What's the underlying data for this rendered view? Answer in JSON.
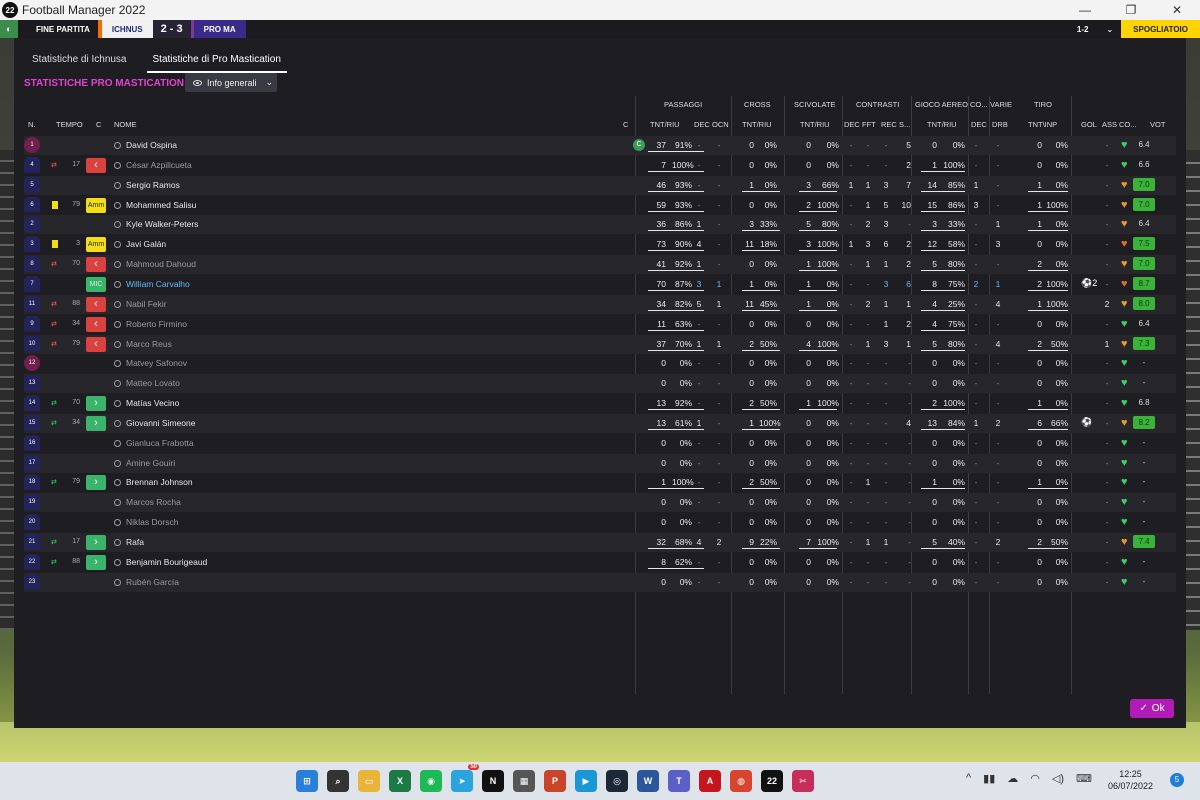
{
  "window": {
    "title": "Football Manager 2022",
    "app_badge": "22",
    "buttons": [
      "—",
      "❐",
      "✕"
    ]
  },
  "gamebar": {
    "club_badge": "◐",
    "phase": "FINE PARTITA",
    "home_team": "ICHNUS",
    "score": "2 - 3",
    "away_team": "PRO MA",
    "counter": "1-2",
    "chevron": "⌄",
    "action": "SPOGLIATOIO"
  },
  "tabs": [
    "Statistiche di Ichnusa",
    "Statistiche di Pro Mastication"
  ],
  "section_title": "STATISTICHE PRO MASTICATION",
  "view_select": "Info generali",
  "ok_label": "Ok",
  "groups": {
    "passaggi": "PASSAGGI",
    "cross": "CROSS",
    "scivolate": "SCIVOLATE",
    "contrasti": "CONTRASTI",
    "aereo": "GIOCO AEREO",
    "co": "CO...",
    "varie": "VARIE",
    "tiro": "TIRO"
  },
  "headers": {
    "n": "N.",
    "tempo": "TEMPO",
    "c": "C",
    "nome": "NOME",
    "cap": "C",
    "pass_tnt": "TNT/RIU",
    "dec": "DEC",
    "ocn": "OCN",
    "cross_tnt": "TNT/RIU",
    "sciv_tnt": "TNT/RIU",
    "c_dec": "DEC",
    "c_fft": "FFT",
    "c_rec": "REC",
    "c_s": "S...",
    "aereo_tnt": "TNT/RIU",
    "co_dec": "DEC",
    "drb": "DRB",
    "tiro_tnt": "TNT\\INP",
    "gol": "GOL",
    "ass": "ASS",
    "cond": "CO...",
    "vot": "VOT"
  },
  "players": [
    {
      "n": "1",
      "gk": true,
      "tempo": "",
      "min": "",
      "badge": "",
      "name": "David Ospina",
      "style": "",
      "cap": "C",
      "pt": "37",
      "pp": "91%",
      "dec": "-",
      "ocn": "-",
      "ct": "0",
      "cp": "0%",
      "st": "0",
      "sp": "0%",
      "cd": "-",
      "cf": "-",
      "cr": "-",
      "cs": "5",
      "at": "0",
      "ap": "0%",
      "ad": "-",
      "drb": "-",
      "tt": "0",
      "tp": "0%",
      "gol": "",
      "ass": "-",
      "heart": "#39d16a",
      "vot": "6.4",
      "vstyle": ""
    },
    {
      "n": "4",
      "gk": false,
      "tempo": "out",
      "min": "17",
      "badge": "out",
      "name": "César Azpilicueta",
      "style": "dim",
      "cap": "",
      "pt": "7",
      "pp": "100%",
      "dec": "-",
      "ocn": "-",
      "ct": "0",
      "cp": "0%",
      "st": "0",
      "sp": "0%",
      "cd": "-",
      "cf": "-",
      "cr": "-",
      "cs": "2",
      "at": "1",
      "ap": "100%",
      "ad": "-",
      "drb": "-",
      "tt": "0",
      "tp": "0%",
      "gol": "",
      "ass": "-",
      "heart": "#39d16a",
      "vot": "6.6",
      "vstyle": ""
    },
    {
      "n": "5",
      "gk": false,
      "tempo": "",
      "min": "",
      "badge": "",
      "name": "Sergio Ramos",
      "style": "",
      "cap": "",
      "pt": "46",
      "pp": "93%",
      "dec": "-",
      "ocn": "-",
      "ct": "1",
      "cp": "0%",
      "st": "3",
      "sp": "66%",
      "cd": "1",
      "cf": "1",
      "cr": "3",
      "cs": "7",
      "at": "14",
      "ap": "85%",
      "ad": "1",
      "drb": "-",
      "tt": "1",
      "tp": "0%",
      "gol": "",
      "ass": "-",
      "heart": "#e59a2a",
      "vot": "7.0",
      "vstyle": "high"
    },
    {
      "n": "6",
      "gk": false,
      "tempo": "yellow",
      "min": "79",
      "badge": "amm",
      "name": "Mohammed Salisu",
      "style": "",
      "cap": "",
      "pt": "59",
      "pp": "93%",
      "dec": "-",
      "ocn": "-",
      "ct": "0",
      "cp": "0%",
      "st": "2",
      "sp": "100%",
      "cd": "-",
      "cf": "1",
      "cr": "5",
      "cs": "10",
      "at": "15",
      "ap": "86%",
      "ad": "3",
      "drb": "-",
      "tt": "1",
      "tp": "100%",
      "gol": "",
      "ass": "-",
      "heart": "#e59a2a",
      "vot": "7.0",
      "vstyle": "high"
    },
    {
      "n": "2",
      "gk": false,
      "tempo": "",
      "min": "",
      "badge": "",
      "name": "Kyle Walker-Peters",
      "style": "",
      "cap": "",
      "pt": "36",
      "pp": "86%",
      "dec": "1",
      "ocn": "-",
      "ct": "3",
      "cp": "33%",
      "st": "5",
      "sp": "80%",
      "cd": "-",
      "cf": "2",
      "cr": "3",
      "cs": "-",
      "at": "3",
      "ap": "33%",
      "ad": "-",
      "drb": "1",
      "tt": "1",
      "tp": "0%",
      "gol": "",
      "ass": "-",
      "heart": "#e59a2a",
      "vot": "6.4",
      "vstyle": ""
    },
    {
      "n": "3",
      "gk": false,
      "tempo": "yellow",
      "min": "3",
      "badge": "amm",
      "name": "Javi Galán",
      "style": "",
      "cap": "",
      "pt": "73",
      "pp": "90%",
      "dec": "4",
      "ocn": "-",
      "ct": "11",
      "cp": "18%",
      "st": "3",
      "sp": "100%",
      "cd": "1",
      "cf": "3",
      "cr": "6",
      "cs": "2",
      "at": "12",
      "ap": "58%",
      "ad": "-",
      "drb": "3",
      "tt": "0",
      "tp": "0%",
      "gol": "",
      "ass": "-",
      "heart": "#e46a2a",
      "vot": "7.5",
      "vstyle": "high"
    },
    {
      "n": "8",
      "gk": false,
      "tempo": "out",
      "min": "70",
      "badge": "out",
      "name": "Mahmoud Dahoud",
      "style": "dim",
      "cap": "",
      "pt": "41",
      "pp": "92%",
      "dec": "1",
      "ocn": "-",
      "ct": "0",
      "cp": "0%",
      "st": "1",
      "sp": "100%",
      "cd": "-",
      "cf": "1",
      "cr": "1",
      "cs": "2",
      "at": "5",
      "ap": "80%",
      "ad": "-",
      "drb": "-",
      "tt": "2",
      "tp": "0%",
      "gol": "",
      "ass": "-",
      "heart": "#e59a2a",
      "vot": "7.0",
      "vstyle": "high"
    },
    {
      "n": "7",
      "gk": false,
      "tempo": "",
      "min": "",
      "badge": "mic",
      "name": "William Carvalho",
      "style": "hl",
      "cap": "",
      "pt": "70",
      "pp": "87%",
      "dec": "3",
      "ocn": "1",
      "ct": "1",
      "cp": "0%",
      "st": "1",
      "sp": "0%",
      "cd": "-",
      "cf": "-",
      "cr": "3",
      "cs": "6",
      "at": "8",
      "ap": "75%",
      "ad": "2",
      "drb": "1",
      "tt": "2",
      "tp": "100%",
      "gol": "⚽2",
      "ass": "-",
      "heart": "#e46a2a",
      "vot": "8.7",
      "vstyle": "high"
    },
    {
      "n": "11",
      "gk": false,
      "tempo": "out",
      "min": "88",
      "badge": "out",
      "name": "Nabil Fekir",
      "style": "dim",
      "cap": "",
      "pt": "34",
      "pp": "82%",
      "dec": "5",
      "ocn": "1",
      "ct": "11",
      "cp": "45%",
      "st": "1",
      "sp": "0%",
      "cd": "-",
      "cf": "2",
      "cr": "1",
      "cs": "1",
      "at": "4",
      "ap": "25%",
      "ad": "-",
      "drb": "4",
      "tt": "1",
      "tp": "100%",
      "gol": "",
      "ass": "2",
      "heart": "#e59a2a",
      "vot": "8.0",
      "vstyle": "high"
    },
    {
      "n": "9",
      "gk": false,
      "tempo": "out",
      "min": "34",
      "badge": "out",
      "name": "Roberto Firmino",
      "style": "dim",
      "cap": "",
      "pt": "11",
      "pp": "63%",
      "dec": "-",
      "ocn": "-",
      "ct": "0",
      "cp": "0%",
      "st": "0",
      "sp": "0%",
      "cd": "-",
      "cf": "-",
      "cr": "1",
      "cs": "2",
      "at": "4",
      "ap": "75%",
      "ad": "-",
      "drb": "-",
      "tt": "0",
      "tp": "0%",
      "gol": "",
      "ass": "-",
      "heart": "#39d16a",
      "vot": "6.4",
      "vstyle": ""
    },
    {
      "n": "10",
      "gk": false,
      "tempo": "out",
      "min": "79",
      "badge": "out",
      "name": "Marco Reus",
      "style": "dim",
      "cap": "",
      "pt": "37",
      "pp": "70%",
      "dec": "1",
      "ocn": "1",
      "ct": "2",
      "cp": "50%",
      "st": "4",
      "sp": "100%",
      "cd": "-",
      "cf": "1",
      "cr": "3",
      "cs": "1",
      "at": "5",
      "ap": "80%",
      "ad": "-",
      "drb": "4",
      "tt": "2",
      "tp": "50%",
      "gol": "",
      "ass": "1",
      "heart": "#e59a2a",
      "vot": "7.3",
      "vstyle": "high"
    },
    {
      "n": "12",
      "gk": true,
      "tempo": "",
      "min": "",
      "badge": "",
      "name": "Matvey Safonov",
      "style": "dim",
      "cap": "",
      "pt": "0",
      "pp": "0%",
      "dec": "-",
      "ocn": "-",
      "ct": "0",
      "cp": "0%",
      "st": "0",
      "sp": "0%",
      "cd": "-",
      "cf": "-",
      "cr": "-",
      "cs": "-",
      "at": "0",
      "ap": "0%",
      "ad": "-",
      "drb": "-",
      "tt": "0",
      "tp": "0%",
      "gol": "",
      "ass": "-",
      "heart": "#39d16a",
      "vot": "-",
      "vstyle": ""
    },
    {
      "n": "13",
      "gk": false,
      "tempo": "",
      "min": "",
      "badge": "",
      "name": "Matteo Lovato",
      "style": "dim",
      "cap": "",
      "pt": "0",
      "pp": "0%",
      "dec": "-",
      "ocn": "-",
      "ct": "0",
      "cp": "0%",
      "st": "0",
      "sp": "0%",
      "cd": "-",
      "cf": "-",
      "cr": "-",
      "cs": "-",
      "at": "0",
      "ap": "0%",
      "ad": "-",
      "drb": "-",
      "tt": "0",
      "tp": "0%",
      "gol": "",
      "ass": "-",
      "heart": "#39d16a",
      "vot": "-",
      "vstyle": ""
    },
    {
      "n": "14",
      "gk": false,
      "tempo": "in",
      "min": "70",
      "badge": "in",
      "name": "Matías Vecino",
      "style": "",
      "cap": "",
      "pt": "13",
      "pp": "92%",
      "dec": "-",
      "ocn": "-",
      "ct": "2",
      "cp": "50%",
      "st": "1",
      "sp": "100%",
      "cd": "-",
      "cf": "-",
      "cr": "-",
      "cs": "-",
      "at": "2",
      "ap": "100%",
      "ad": "-",
      "drb": "-",
      "tt": "1",
      "tp": "0%",
      "gol": "",
      "ass": "-",
      "heart": "#39d16a",
      "vot": "6.8",
      "vstyle": ""
    },
    {
      "n": "15",
      "gk": false,
      "tempo": "in",
      "min": "34",
      "badge": "in",
      "name": "Giovanni Simeone",
      "style": "",
      "cap": "",
      "pt": "13",
      "pp": "61%",
      "dec": "1",
      "ocn": "-",
      "ct": "1",
      "cp": "100%",
      "st": "0",
      "sp": "0%",
      "cd": "-",
      "cf": "-",
      "cr": "-",
      "cs": "4",
      "at": "13",
      "ap": "84%",
      "ad": "1",
      "drb": "2",
      "tt": "6",
      "tp": "66%",
      "gol": "⚽",
      "ass": "-",
      "heart": "#e59a2a",
      "vot": "8.2",
      "vstyle": "high"
    },
    {
      "n": "16",
      "gk": false,
      "tempo": "",
      "min": "",
      "badge": "",
      "name": "Gianluca Frabotta",
      "style": "dim",
      "cap": "",
      "pt": "0",
      "pp": "0%",
      "dec": "-",
      "ocn": "-",
      "ct": "0",
      "cp": "0%",
      "st": "0",
      "sp": "0%",
      "cd": "-",
      "cf": "-",
      "cr": "-",
      "cs": "-",
      "at": "0",
      "ap": "0%",
      "ad": "-",
      "drb": "-",
      "tt": "0",
      "tp": "0%",
      "gol": "",
      "ass": "-",
      "heart": "#39d16a",
      "vot": "-",
      "vstyle": ""
    },
    {
      "n": "17",
      "gk": false,
      "tempo": "",
      "min": "",
      "badge": "",
      "name": "Amine Gouiri",
      "style": "dim",
      "cap": "",
      "pt": "0",
      "pp": "0%",
      "dec": "-",
      "ocn": "-",
      "ct": "0",
      "cp": "0%",
      "st": "0",
      "sp": "0%",
      "cd": "-",
      "cf": "-",
      "cr": "-",
      "cs": "-",
      "at": "0",
      "ap": "0%",
      "ad": "-",
      "drb": "-",
      "tt": "0",
      "tp": "0%",
      "gol": "",
      "ass": "-",
      "heart": "#39d16a",
      "vot": "-",
      "vstyle": ""
    },
    {
      "n": "18",
      "gk": false,
      "tempo": "in",
      "min": "79",
      "badge": "in",
      "name": "Brennan Johnson",
      "style": "",
      "cap": "",
      "pt": "1",
      "pp": "100%",
      "dec": "-",
      "ocn": "-",
      "ct": "2",
      "cp": "50%",
      "st": "0",
      "sp": "0%",
      "cd": "-",
      "cf": "1",
      "cr": "-",
      "cs": "-",
      "at": "1",
      "ap": "0%",
      "ad": "-",
      "drb": "-",
      "tt": "1",
      "tp": "0%",
      "gol": "",
      "ass": "-",
      "heart": "#39d16a",
      "vot": "-",
      "vstyle": ""
    },
    {
      "n": "19",
      "gk": false,
      "tempo": "",
      "min": "",
      "badge": "",
      "name": "Marcos Rocha",
      "style": "dim",
      "cap": "",
      "pt": "0",
      "pp": "0%",
      "dec": "-",
      "ocn": "-",
      "ct": "0",
      "cp": "0%",
      "st": "0",
      "sp": "0%",
      "cd": "-",
      "cf": "-",
      "cr": "-",
      "cs": "-",
      "at": "0",
      "ap": "0%",
      "ad": "-",
      "drb": "-",
      "tt": "0",
      "tp": "0%",
      "gol": "",
      "ass": "-",
      "heart": "#39d16a",
      "vot": "-",
      "vstyle": ""
    },
    {
      "n": "20",
      "gk": false,
      "tempo": "",
      "min": "",
      "badge": "",
      "name": "Niklas Dorsch",
      "style": "dim",
      "cap": "",
      "pt": "0",
      "pp": "0%",
      "dec": "-",
      "ocn": "-",
      "ct": "0",
      "cp": "0%",
      "st": "0",
      "sp": "0%",
      "cd": "-",
      "cf": "-",
      "cr": "-",
      "cs": "-",
      "at": "0",
      "ap": "0%",
      "ad": "-",
      "drb": "-",
      "tt": "0",
      "tp": "0%",
      "gol": "",
      "ass": "-",
      "heart": "#39d16a",
      "vot": "-",
      "vstyle": ""
    },
    {
      "n": "21",
      "gk": false,
      "tempo": "in",
      "min": "17",
      "badge": "in",
      "name": "Rafa",
      "style": "",
      "cap": "",
      "pt": "32",
      "pp": "68%",
      "dec": "4",
      "ocn": "2",
      "ct": "9",
      "cp": "22%",
      "st": "7",
      "sp": "100%",
      "cd": "-",
      "cf": "1",
      "cr": "1",
      "cs": "-",
      "at": "5",
      "ap": "40%",
      "ad": "-",
      "drb": "2",
      "tt": "2",
      "tp": "50%",
      "gol": "",
      "ass": "-",
      "heart": "#e59a2a",
      "vot": "7.4",
      "vstyle": "high"
    },
    {
      "n": "22",
      "gk": false,
      "tempo": "in",
      "min": "88",
      "badge": "in",
      "name": "Benjamin Bourigeaud",
      "style": "",
      "cap": "",
      "pt": "8",
      "pp": "62%",
      "dec": "-",
      "ocn": "-",
      "ct": "0",
      "cp": "0%",
      "st": "0",
      "sp": "0%",
      "cd": "-",
      "cf": "-",
      "cr": "-",
      "cs": "-",
      "at": "0",
      "ap": "0%",
      "ad": "-",
      "drb": "-",
      "tt": "0",
      "tp": "0%",
      "gol": "",
      "ass": "-",
      "heart": "#39d16a",
      "vot": "-",
      "vstyle": ""
    },
    {
      "n": "23",
      "gk": false,
      "tempo": "",
      "min": "",
      "badge": "",
      "name": "Rubén García",
      "style": "dim",
      "cap": "",
      "pt": "0",
      "pp": "0%",
      "dec": "-",
      "ocn": "-",
      "ct": "0",
      "cp": "0%",
      "st": "0",
      "sp": "0%",
      "cd": "-",
      "cf": "-",
      "cr": "-",
      "cs": "-",
      "at": "0",
      "ap": "0%",
      "ad": "-",
      "drb": "-",
      "tt": "0",
      "tp": "0%",
      "gol": "",
      "ass": "-",
      "heart": "#39d16a",
      "vot": "-",
      "vstyle": ""
    }
  ],
  "badge_labels": {
    "amm": "Amm",
    "mic": "MIC",
    "out": "‹",
    "in": "›"
  },
  "taskbar": {
    "apps": [
      {
        "name": "start-icon",
        "label": "⊞",
        "color": "#2a7fd8"
      },
      {
        "name": "search-icon",
        "label": "⌕",
        "color": "#333"
      },
      {
        "name": "file-explorer-icon",
        "label": "▭",
        "color": "#e8b43a"
      },
      {
        "name": "excel-icon",
        "label": "X",
        "color": "#1e7a45"
      },
      {
        "name": "spotify-icon",
        "label": "◉",
        "color": "#1db954"
      },
      {
        "name": "telegram-icon",
        "label": "➤",
        "color": "#2aa3de",
        "badge": "50"
      },
      {
        "name": "netflix-icon",
        "label": "N",
        "color": "#111"
      },
      {
        "name": "calculator-icon",
        "label": "▦",
        "color": "#555"
      },
      {
        "name": "powerpoint-icon",
        "label": "P",
        "color": "#c9452a"
      },
      {
        "name": "prime-video-icon",
        "label": "▶",
        "color": "#1a98d5"
      },
      {
        "name": "steam-icon",
        "label": "◎",
        "color": "#1b2838"
      },
      {
        "name": "word-icon",
        "label": "W",
        "color": "#2b579a"
      },
      {
        "name": "teams-icon",
        "label": "T",
        "color": "#5b5fc7"
      },
      {
        "name": "acrobat-icon",
        "label": "A",
        "color": "#c4161c"
      },
      {
        "name": "chrome-icon",
        "label": "◍",
        "color": "#d8442e"
      },
      {
        "name": "football-manager-icon",
        "label": "22",
        "color": "#111"
      },
      {
        "name": "snipping-tool-icon",
        "label": "✂",
        "color": "#c62d5a"
      }
    ],
    "tray": [
      "^",
      "▮▮",
      "☁",
      "◠",
      "◁)",
      "⌨"
    ],
    "time": "12:25",
    "date": "06/07/2022",
    "notifications": "5"
  }
}
